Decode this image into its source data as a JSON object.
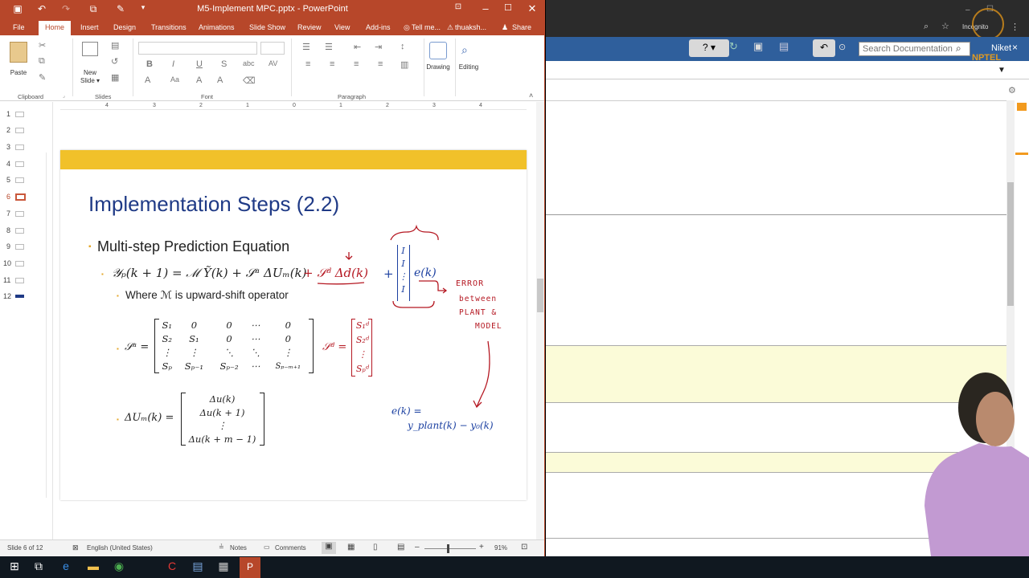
{
  "powerpoint": {
    "window_title": "M5-Implement MPC.pptx - PowerPoint",
    "tabs": [
      "File",
      "Home",
      "Insert",
      "Design",
      "Transitions",
      "Animations",
      "Slide Show",
      "Review",
      "View",
      "Add-ins"
    ],
    "tell_me": "Tell me...",
    "user": "thuaksh...",
    "share": "Share",
    "ribbon": {
      "paste": "Paste",
      "new_slide": "New\nSlide",
      "drawing": "Drawing",
      "editing": "Editing",
      "groups": [
        "Clipboard",
        "Slides",
        "Font",
        "Paragraph"
      ]
    },
    "ruler_ticks": [
      "4",
      "3",
      "2",
      "1",
      "0",
      "1",
      "2",
      "3",
      "4"
    ],
    "thumbnail_numbers": [
      "1",
      "2",
      "3",
      "4",
      "5",
      "6",
      "7",
      "8",
      "9",
      "10",
      "11",
      "12"
    ],
    "active_slide": "6",
    "slide": {
      "title": "Implementation Steps (2.2)",
      "bullet1": "Multi-step Prediction Equation",
      "eq_main_black": "𝒴ₚ(k + 1) = ℳ Ỹ(k) + 𝒮ᵘ ΔUₘ(k)",
      "eq_main_red": "+ 𝒮ᵈ Δd(k)",
      "eq_plus": "+",
      "eq_ek": "e(k)",
      "sub_bullet": "Where ℳ is upward-shift operator",
      "su_label": "𝒮ᵘ =",
      "su_matrix": [
        [
          "S₁",
          "0",
          "0",
          "⋯",
          "0"
        ],
        [
          "S₂",
          "S₁",
          "0",
          "⋯",
          "0"
        ],
        [
          "⋮",
          "⋮",
          "⋱",
          "⋱",
          "⋮"
        ],
        [
          "Sₚ",
          "Sₚ₋₁",
          "Sₚ₋₂",
          "⋯",
          "Sₚ₋ₘ₊₁"
        ]
      ],
      "sd_label": "𝒮ᵈ =",
      "sd_matrix": [
        "S₁ᵈ",
        "S₂ᵈ",
        "⋮",
        "Sₚᵈ"
      ],
      "du_label": "ΔUₘ(k) =",
      "du_vector": [
        "Δu(k)",
        "Δu(k + 1)",
        "⋮",
        "Δu(k + m − 1)"
      ],
      "identity_vector": [
        "I",
        "I",
        "⋮",
        "I"
      ],
      "annotation_lines": [
        "ERROR",
        "between",
        "PLANT &",
        "MODEL"
      ],
      "ek_def_1": "e(k) =",
      "ek_def_2": "y_plant(k) − y₀(k)"
    },
    "status": {
      "slide_of": "Slide 6 of 12",
      "language": "English (United States)",
      "notes": "Notes",
      "comments": "Comments",
      "zoom": "91%"
    }
  },
  "right_app": {
    "incognito": "Incognito",
    "user": "Niket",
    "search_placeholder": "Search Documentation",
    "watermark": "NPTEL"
  },
  "colors": {
    "ppt_accent": "#b7472a",
    "slide_band": "#f1c12a",
    "title_blue": "#1f3a86",
    "ink_red": "#b51822",
    "ink_blue": "#1a3fa0"
  }
}
